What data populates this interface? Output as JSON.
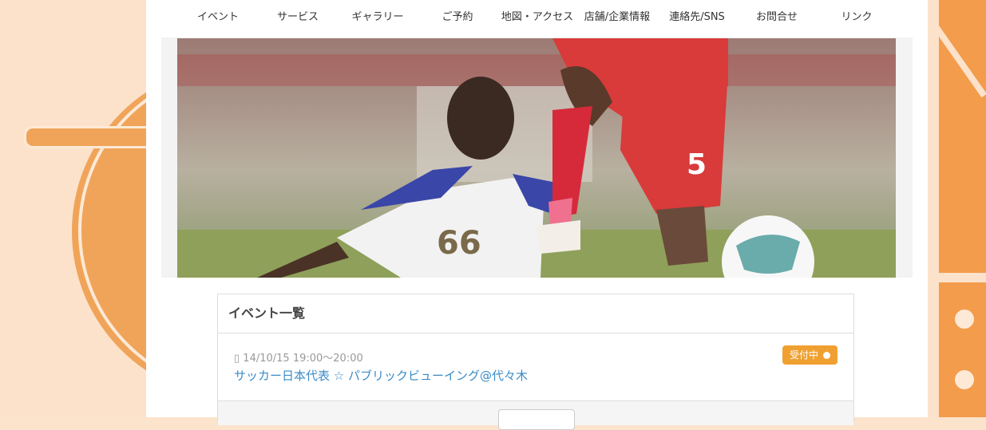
{
  "nav": {
    "items": [
      "イベント",
      "サービス",
      "ギャラリー",
      "ご予約",
      "地図・アクセス",
      "店舗/企業情報",
      "連絡先/SNS",
      "お問合せ",
      "リンク"
    ]
  },
  "hero": {
    "player_left_number": "66",
    "player_right_number": "5"
  },
  "events": {
    "title": "イベント一覧",
    "items": [
      {
        "date": "14/10/15 19:00〜20:00",
        "title": "サッカー日本代表 ☆ パブリックビューイング@代々木",
        "status": "受付中"
      }
    ]
  },
  "colors": {
    "accent_orange": "#f39c4c",
    "link_blue": "#3a8bc6",
    "badge_orange": "#f0a030"
  }
}
